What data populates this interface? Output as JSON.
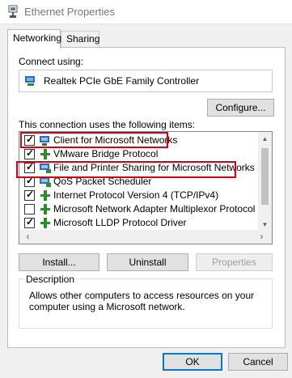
{
  "window": {
    "title": "Ethernet Properties",
    "icon": "network-adapter-icon"
  },
  "tabs": [
    {
      "label": "Networking",
      "active": true
    },
    {
      "label": "Sharing",
      "active": false
    }
  ],
  "connect_using": {
    "label": "Connect using:",
    "adapter_name": "Realtek PCIe GbE Family Controller",
    "configure_button": "Configure..."
  },
  "items_section": {
    "label": "This connection uses the following items:",
    "items": [
      {
        "label": "Client for Microsoft Networks",
        "checked": true,
        "icon": "network-client-icon"
      },
      {
        "label": "VMware Bridge Protocol",
        "checked": true,
        "icon": "protocol-icon"
      },
      {
        "label": "File and Printer Sharing for Microsoft Networks",
        "checked": true,
        "icon": "network-service-icon"
      },
      {
        "label": "QoS Packet Scheduler",
        "checked": true,
        "icon": "network-service-icon"
      },
      {
        "label": "Internet Protocol Version 4 (TCP/IPv4)",
        "checked": true,
        "icon": "protocol-icon"
      },
      {
        "label": "Microsoft Network Adapter Multiplexor Protocol",
        "checked": false,
        "icon": "protocol-icon"
      },
      {
        "label": "Microsoft LLDP Protocol Driver",
        "checked": true,
        "icon": "protocol-icon"
      }
    ]
  },
  "item_buttons": {
    "install": "Install...",
    "uninstall": "Uninstall",
    "properties": "Properties"
  },
  "description": {
    "title": "Description",
    "text": "Allows other computers to access resources on your computer using a Microsoft network."
  },
  "dialog_buttons": {
    "ok": "OK",
    "cancel": "Cancel"
  },
  "colors": {
    "highlight": "#d0021b",
    "accent": "#0078d7",
    "dialog_bg": "#f0f0f0"
  }
}
